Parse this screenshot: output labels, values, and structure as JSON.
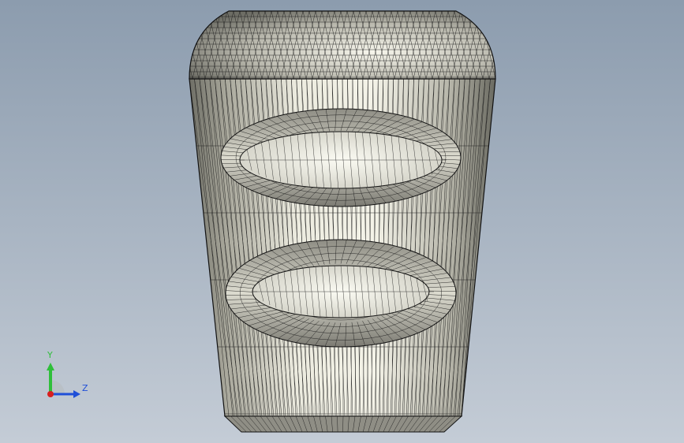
{
  "viewport": {
    "background_top": "#8c9cae",
    "background_bottom": "#c4ccd6"
  },
  "model": {
    "render_mode": "mesh-wireframe-shaded",
    "surface_color": "#e9e8dc",
    "edge_color": "#1c1c1c"
  },
  "triad": {
    "y_label": "Y",
    "z_label": "Z",
    "y_color": "#2fbf3a",
    "z_color": "#1f4fd8",
    "x_color": "#d81f1f"
  }
}
